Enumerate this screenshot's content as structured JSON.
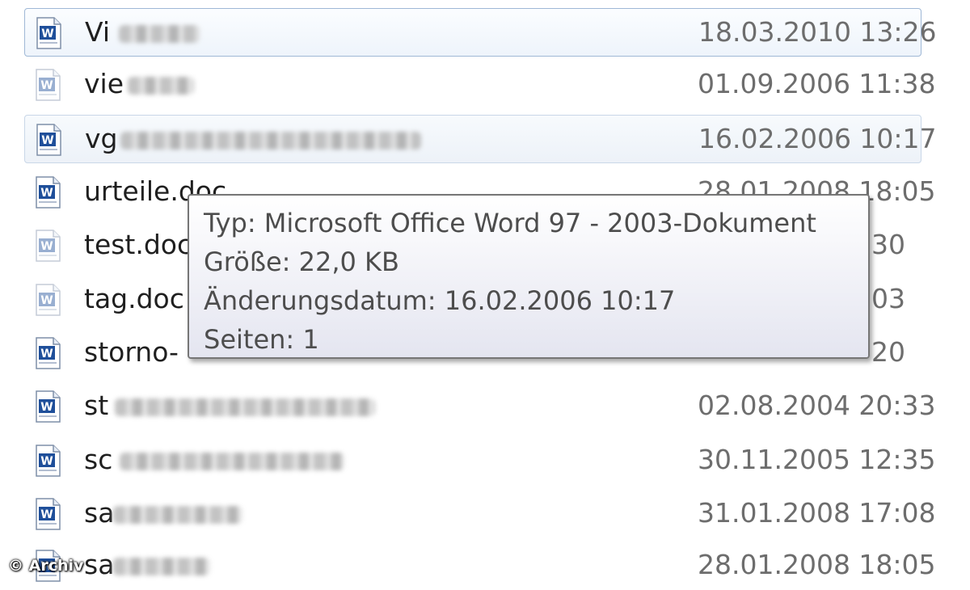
{
  "files": [
    {
      "name": "Vi",
      "date": "18.03.2010 13:26",
      "state": "selected",
      "icon": "word-doc-icon"
    },
    {
      "name": "vie",
      "date": "01.09.2006 11:38",
      "state": "normal",
      "icon": "word-doc-icon-faded"
    },
    {
      "name": "vg",
      "date": "16.02.2006 10:17",
      "state": "hover",
      "icon": "word-doc-icon"
    },
    {
      "name": "urteile.doc",
      "date": "28.01.2008 18:05",
      "state": "normal",
      "icon": "word-doc-icon"
    },
    {
      "name": "test.doc",
      "date": "30",
      "state": "normal",
      "icon": "word-doc-icon-faded"
    },
    {
      "name": "tag.doc",
      "date": "03",
      "state": "normal",
      "icon": "word-doc-icon-faded"
    },
    {
      "name": "storno-",
      "date": "20",
      "state": "normal",
      "icon": "word-doc-icon"
    },
    {
      "name": "st",
      "date": "02.08.2004 20:33",
      "state": "normal",
      "icon": "word-doc-icon"
    },
    {
      "name": "sc",
      "date": "30.11.2005 12:35",
      "state": "normal",
      "icon": "word-doc-icon"
    },
    {
      "name": "sa",
      "date": "31.01.2008 17:08",
      "state": "normal",
      "icon": "word-doc-icon"
    },
    {
      "name": "sa",
      "date": "28.01.2008 18:05",
      "state": "normal",
      "icon": "word-doc-icon"
    }
  ],
  "tooltip": {
    "type": "Typ: Microsoft Office Word 97 - 2003-Dokument",
    "size": "Größe: 22,0 KB",
    "modified": "Änderungsdatum: 16.02.2006 10:17",
    "pages": "Seiten: 1"
  },
  "watermark": "© Archiv",
  "colors": {
    "selection_border": "#9fb8d6",
    "date_text": "#6d6d6d",
    "icon_blue": "#1f4f9a"
  }
}
